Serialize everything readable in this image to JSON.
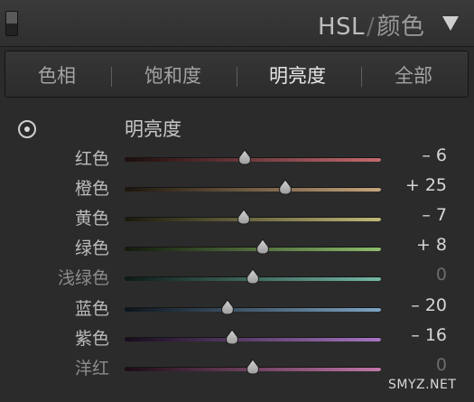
{
  "header": {
    "title": "HSL",
    "separator": "/",
    "subtitle": "颜色"
  },
  "tabs": [
    {
      "label": "色相",
      "active": false
    },
    {
      "label": "饱和度",
      "active": false
    },
    {
      "label": "明亮度",
      "active": true
    },
    {
      "label": "全部",
      "active": false
    }
  ],
  "section": {
    "title": "明亮度",
    "target_icon": "target-adjust-icon"
  },
  "sliders": [
    {
      "label": "红色",
      "value": -6,
      "display": "– 6",
      "track_start": "#1c0d0d",
      "track_end": "#c56a70",
      "dim": false
    },
    {
      "label": "橙色",
      "value": 25,
      "display": "+ 25",
      "track_start": "#1c150c",
      "track_end": "#c7a57c",
      "dim": false
    },
    {
      "label": "黄色",
      "value": -7,
      "display": "– 7",
      "track_start": "#1a190c",
      "track_end": "#c1b877",
      "dim": false
    },
    {
      "label": "绿色",
      "value": 8,
      "display": "+ 8",
      "track_start": "#111a0c",
      "track_end": "#8dbd6c",
      "dim": false
    },
    {
      "label": "浅绿色",
      "value": 0,
      "display": "0",
      "track_start": "#0c1a18",
      "track_end": "#74b8a5",
      "dim": true
    },
    {
      "label": "蓝色",
      "value": -20,
      "display": "– 20",
      "track_start": "#0c141c",
      "track_end": "#7ea6c6",
      "dim": false
    },
    {
      "label": "紫色",
      "value": -16,
      "display": "– 16",
      "track_start": "#170c1c",
      "track_end": "#a775c2",
      "dim": false
    },
    {
      "label": "洋红",
      "value": 0,
      "display": "0",
      "track_start": "#1c0c16",
      "track_end": "#c276a9",
      "dim": true
    }
  ],
  "slider_range": [
    -100,
    100
  ],
  "watermark": "SMYZ.NET"
}
